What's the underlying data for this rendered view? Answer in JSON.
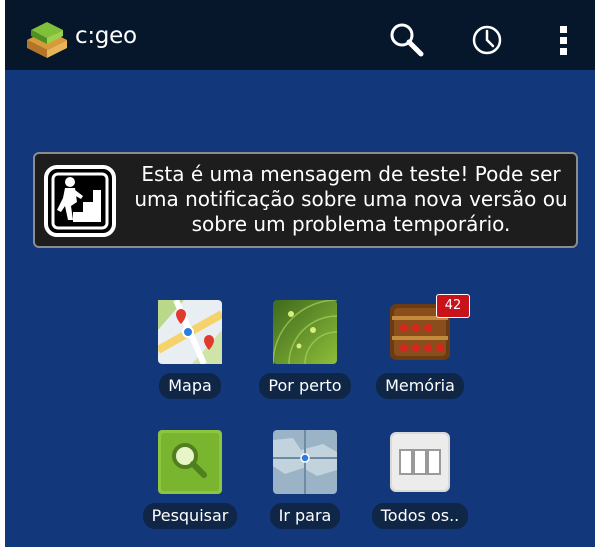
{
  "app": {
    "title": "c:geo"
  },
  "actionbar": {
    "search_icon": "search-icon",
    "history_icon": "clock-icon",
    "menu_icon": "overflow-menu-icon"
  },
  "notification": {
    "icon": "hiker-stairs-icon",
    "message": "Esta é uma mensagem de teste! Pode ser uma notificação sobre uma nova versão ou sobre um problema temporário."
  },
  "tiles": [
    {
      "id": "map",
      "label": "Mapa",
      "icon": "map-icon"
    },
    {
      "id": "nearby",
      "label": "Por perto",
      "icon": "radar-icon"
    },
    {
      "id": "stored",
      "label": "Memória",
      "icon": "treasure-chest-icon",
      "badge": "42"
    },
    {
      "id": "search",
      "label": "Pesquisar",
      "icon": "magnifier-icon"
    },
    {
      "id": "goto",
      "label": "Ir para",
      "icon": "target-map-icon"
    },
    {
      "id": "all",
      "label": "Todos os..",
      "icon": "list-icon"
    }
  ],
  "colors": {
    "actionbar": "#06162b",
    "background": "#12377a",
    "label_pill": "#0f2647",
    "badge": "#c8131b"
  }
}
